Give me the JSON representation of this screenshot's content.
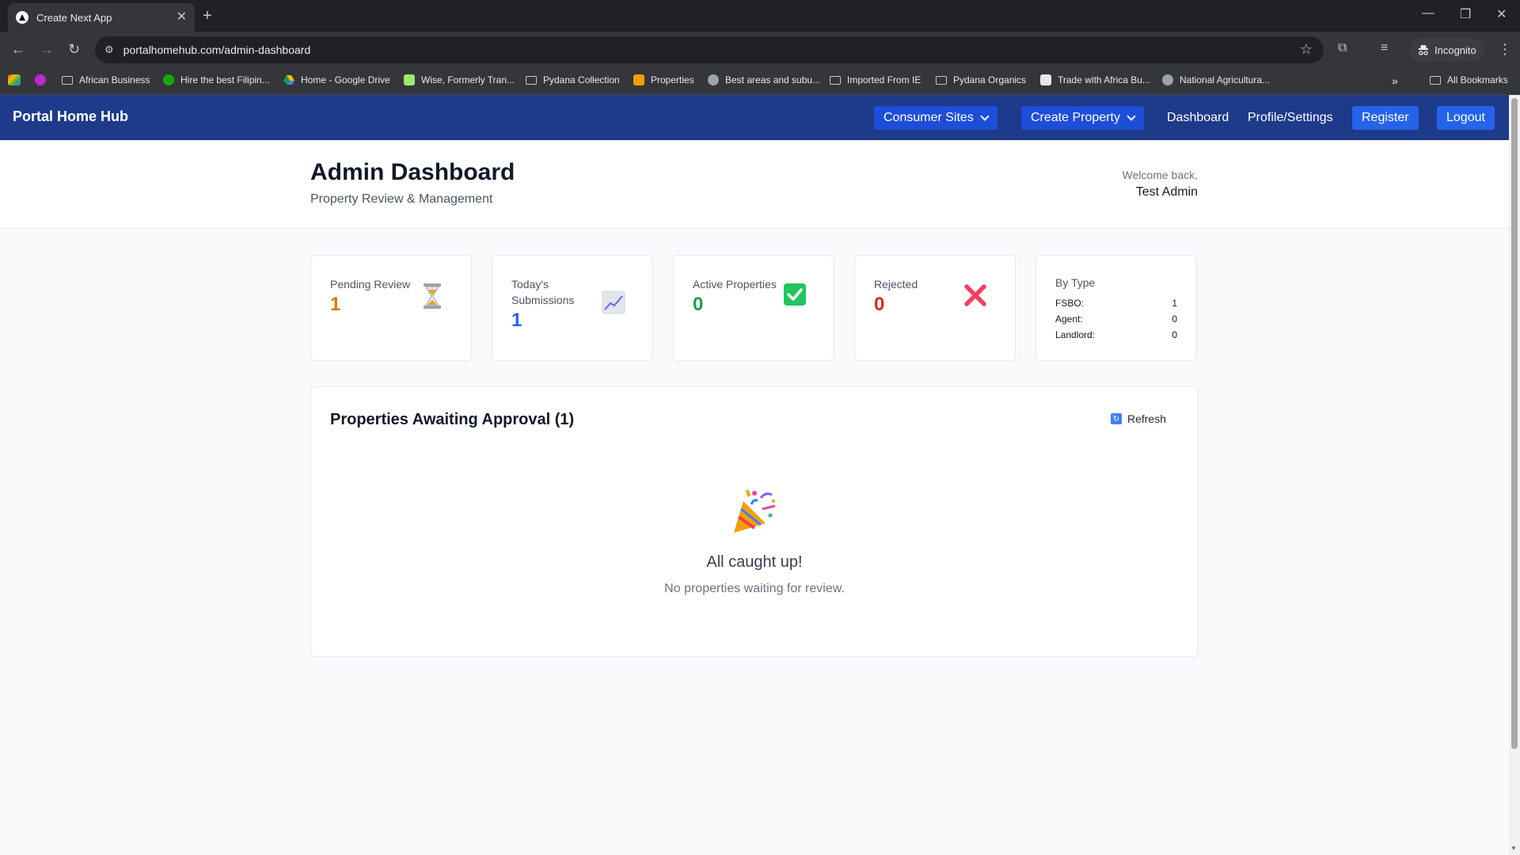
{
  "browser": {
    "tab_title": "Create Next App",
    "url": "portalhomehub.com/admin-dashboard",
    "incognito_label": "Incognito",
    "bookmarks": [
      {
        "label": "African Business",
        "kind": "folder"
      },
      {
        "label": "Hire the best Filipin...",
        "kind": "site"
      },
      {
        "label": "Home - Google Drive",
        "kind": "site"
      },
      {
        "label": "Wise, Formerly Tran...",
        "kind": "site"
      },
      {
        "label": "Pydana Collection",
        "kind": "folder"
      },
      {
        "label": "Properties",
        "kind": "site"
      },
      {
        "label": "Best areas and subu...",
        "kind": "site"
      },
      {
        "label": "Imported From IE",
        "kind": "folder"
      },
      {
        "label": "Pydana Organics",
        "kind": "folder"
      },
      {
        "label": "Trade with Africa Bu...",
        "kind": "site"
      },
      {
        "label": "National Agricultura...",
        "kind": "site"
      }
    ],
    "all_bookmarks_label": "All Bookmarks"
  },
  "nav": {
    "brand": "Portal Home Hub",
    "consumer_sites": "Consumer Sites",
    "create_property": "Create Property",
    "dashboard": "Dashboard",
    "profile_settings": "Profile/Settings",
    "register": "Register",
    "logout": "Logout"
  },
  "header": {
    "title": "Admin Dashboard",
    "subtitle": "Property Review & Management",
    "welcome": "Welcome back,",
    "user_name": "Test Admin"
  },
  "stats": {
    "pending": {
      "label": "Pending Review",
      "value": "1",
      "color": "#d97706",
      "icon": "hourglass-icon"
    },
    "today": {
      "label": "Today's Submissions",
      "value": "1",
      "color": "#2563eb",
      "icon": "chart-increasing-icon"
    },
    "active": {
      "label": "Active Properties",
      "value": "0",
      "color": "#16a34a",
      "icon": "check-box-icon"
    },
    "rejected": {
      "label": "Rejected",
      "value": "0",
      "color": "#dc2626",
      "icon": "cross-mark-icon"
    },
    "by_type": {
      "label": "By Type",
      "rows": [
        {
          "name": "FSBO:",
          "count": "1"
        },
        {
          "name": "Agent:",
          "count": "0"
        },
        {
          "name": "Landlord:",
          "count": "0"
        }
      ]
    }
  },
  "approval": {
    "title": "Properties Awaiting Approval (1)",
    "refresh_label": "Refresh",
    "empty_title": "All caught up!",
    "empty_sub": "No properties waiting for review.",
    "empty_icon": "party-popper-icon"
  },
  "colors": {
    "nav_bg": "#1e3a8a",
    "nav_button": "#1d4ed8",
    "accent": "#2563eb"
  }
}
